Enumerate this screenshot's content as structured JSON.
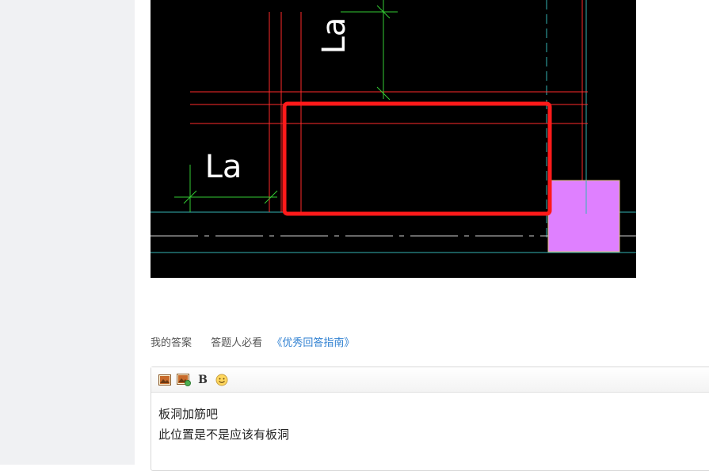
{
  "image": {
    "alt": "",
    "dim_label_vertical": "La",
    "dim_label_horizontal": "La",
    "colors": {
      "background": "#000000",
      "rebar_red": "#ff2a2a",
      "highlight_box": "#ff1a1a",
      "dimension_green": "#33cc33",
      "axis_cyan": "#33b5b5",
      "column_magenta": "#df80ff",
      "text_white": "#ffffff"
    }
  },
  "answer_section": {
    "my_answer_label": "我的答案",
    "must_read_label": "答题人必看",
    "guide_link": "《优秀回答指南》"
  },
  "editor": {
    "toolbar": {
      "image_icon": "image-icon",
      "image_upload_icon": "image-upload-icon",
      "bold_label": "B",
      "emoji_icon": "emoji-icon"
    },
    "content_lines": [
      "板洞加筋吧",
      "此位置是不是应该有板洞"
    ]
  }
}
